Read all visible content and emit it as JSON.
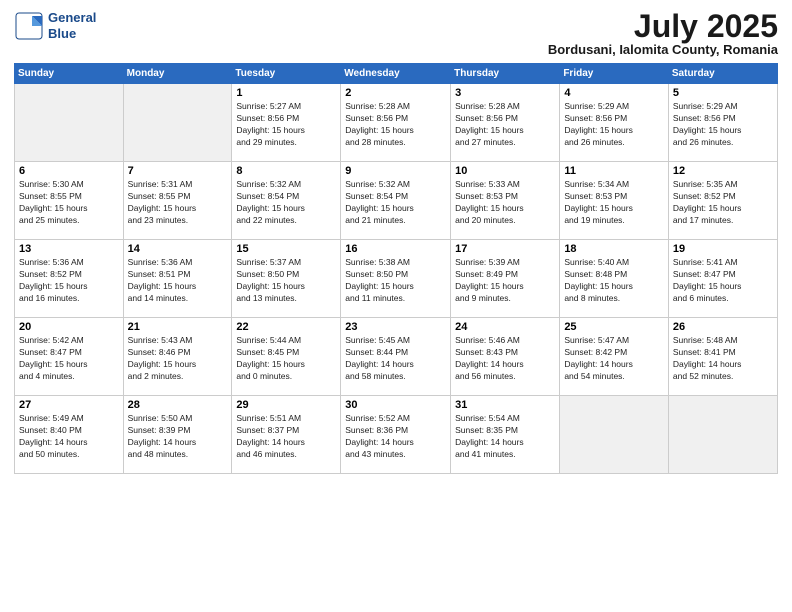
{
  "header": {
    "logo_line1": "General",
    "logo_line2": "Blue",
    "month": "July 2025",
    "location": "Bordusani, Ialomita County, Romania"
  },
  "weekdays": [
    "Sunday",
    "Monday",
    "Tuesday",
    "Wednesday",
    "Thursday",
    "Friday",
    "Saturday"
  ],
  "weeks": [
    [
      {
        "day": "",
        "info": ""
      },
      {
        "day": "",
        "info": ""
      },
      {
        "day": "1",
        "info": "Sunrise: 5:27 AM\nSunset: 8:56 PM\nDaylight: 15 hours\nand 29 minutes."
      },
      {
        "day": "2",
        "info": "Sunrise: 5:28 AM\nSunset: 8:56 PM\nDaylight: 15 hours\nand 28 minutes."
      },
      {
        "day": "3",
        "info": "Sunrise: 5:28 AM\nSunset: 8:56 PM\nDaylight: 15 hours\nand 27 minutes."
      },
      {
        "day": "4",
        "info": "Sunrise: 5:29 AM\nSunset: 8:56 PM\nDaylight: 15 hours\nand 26 minutes."
      },
      {
        "day": "5",
        "info": "Sunrise: 5:29 AM\nSunset: 8:56 PM\nDaylight: 15 hours\nand 26 minutes."
      }
    ],
    [
      {
        "day": "6",
        "info": "Sunrise: 5:30 AM\nSunset: 8:55 PM\nDaylight: 15 hours\nand 25 minutes."
      },
      {
        "day": "7",
        "info": "Sunrise: 5:31 AM\nSunset: 8:55 PM\nDaylight: 15 hours\nand 23 minutes."
      },
      {
        "day": "8",
        "info": "Sunrise: 5:32 AM\nSunset: 8:54 PM\nDaylight: 15 hours\nand 22 minutes."
      },
      {
        "day": "9",
        "info": "Sunrise: 5:32 AM\nSunset: 8:54 PM\nDaylight: 15 hours\nand 21 minutes."
      },
      {
        "day": "10",
        "info": "Sunrise: 5:33 AM\nSunset: 8:53 PM\nDaylight: 15 hours\nand 20 minutes."
      },
      {
        "day": "11",
        "info": "Sunrise: 5:34 AM\nSunset: 8:53 PM\nDaylight: 15 hours\nand 19 minutes."
      },
      {
        "day": "12",
        "info": "Sunrise: 5:35 AM\nSunset: 8:52 PM\nDaylight: 15 hours\nand 17 minutes."
      }
    ],
    [
      {
        "day": "13",
        "info": "Sunrise: 5:36 AM\nSunset: 8:52 PM\nDaylight: 15 hours\nand 16 minutes."
      },
      {
        "day": "14",
        "info": "Sunrise: 5:36 AM\nSunset: 8:51 PM\nDaylight: 15 hours\nand 14 minutes."
      },
      {
        "day": "15",
        "info": "Sunrise: 5:37 AM\nSunset: 8:50 PM\nDaylight: 15 hours\nand 13 minutes."
      },
      {
        "day": "16",
        "info": "Sunrise: 5:38 AM\nSunset: 8:50 PM\nDaylight: 15 hours\nand 11 minutes."
      },
      {
        "day": "17",
        "info": "Sunrise: 5:39 AM\nSunset: 8:49 PM\nDaylight: 15 hours\nand 9 minutes."
      },
      {
        "day": "18",
        "info": "Sunrise: 5:40 AM\nSunset: 8:48 PM\nDaylight: 15 hours\nand 8 minutes."
      },
      {
        "day": "19",
        "info": "Sunrise: 5:41 AM\nSunset: 8:47 PM\nDaylight: 15 hours\nand 6 minutes."
      }
    ],
    [
      {
        "day": "20",
        "info": "Sunrise: 5:42 AM\nSunset: 8:47 PM\nDaylight: 15 hours\nand 4 minutes."
      },
      {
        "day": "21",
        "info": "Sunrise: 5:43 AM\nSunset: 8:46 PM\nDaylight: 15 hours\nand 2 minutes."
      },
      {
        "day": "22",
        "info": "Sunrise: 5:44 AM\nSunset: 8:45 PM\nDaylight: 15 hours\nand 0 minutes."
      },
      {
        "day": "23",
        "info": "Sunrise: 5:45 AM\nSunset: 8:44 PM\nDaylight: 14 hours\nand 58 minutes."
      },
      {
        "day": "24",
        "info": "Sunrise: 5:46 AM\nSunset: 8:43 PM\nDaylight: 14 hours\nand 56 minutes."
      },
      {
        "day": "25",
        "info": "Sunrise: 5:47 AM\nSunset: 8:42 PM\nDaylight: 14 hours\nand 54 minutes."
      },
      {
        "day": "26",
        "info": "Sunrise: 5:48 AM\nSunset: 8:41 PM\nDaylight: 14 hours\nand 52 minutes."
      }
    ],
    [
      {
        "day": "27",
        "info": "Sunrise: 5:49 AM\nSunset: 8:40 PM\nDaylight: 14 hours\nand 50 minutes."
      },
      {
        "day": "28",
        "info": "Sunrise: 5:50 AM\nSunset: 8:39 PM\nDaylight: 14 hours\nand 48 minutes."
      },
      {
        "day": "29",
        "info": "Sunrise: 5:51 AM\nSunset: 8:37 PM\nDaylight: 14 hours\nand 46 minutes."
      },
      {
        "day": "30",
        "info": "Sunrise: 5:52 AM\nSunset: 8:36 PM\nDaylight: 14 hours\nand 43 minutes."
      },
      {
        "day": "31",
        "info": "Sunrise: 5:54 AM\nSunset: 8:35 PM\nDaylight: 14 hours\nand 41 minutes."
      },
      {
        "day": "",
        "info": ""
      },
      {
        "day": "",
        "info": ""
      }
    ]
  ]
}
